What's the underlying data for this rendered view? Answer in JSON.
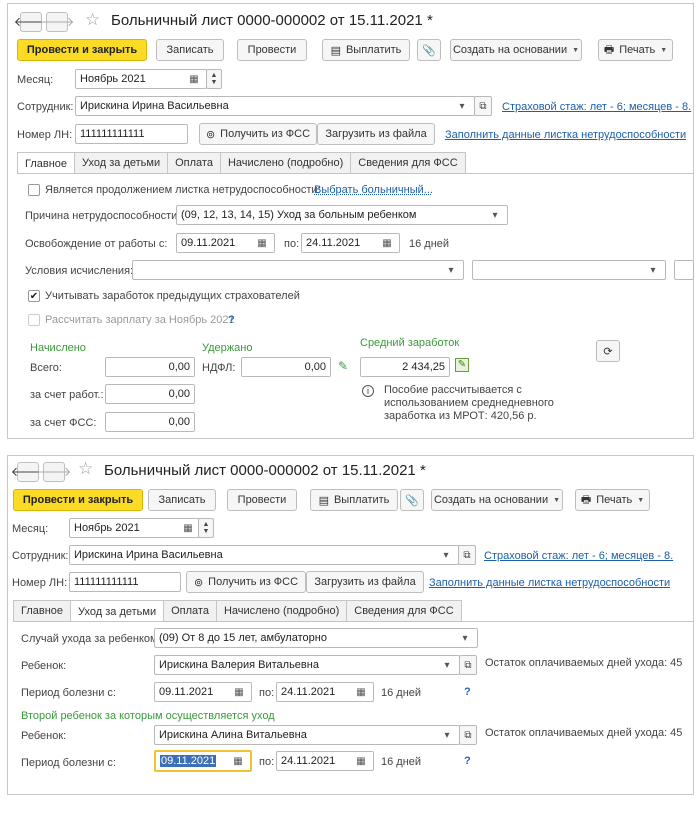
{
  "top": {
    "title": "Больничный лист 0000-000002 от 15.11.2021 *",
    "toolbar": {
      "post_close": "Провести и закрыть",
      "save": "Записать",
      "post": "Провести",
      "pay": "Выплатить",
      "create_based": "Создать на основании",
      "print": "Печать"
    },
    "month_label": "Месяц:",
    "month_value": "Ноябрь 2021",
    "employee_label": "Сотрудник:",
    "employee_value": "Ирискина Ирина Васильевна",
    "insurance_link": "Страховой стаж: лет - 6; месяцев - 8.",
    "ln_label": "Номер ЛН:",
    "ln_value": "111111111111",
    "get_fss": "Получить из ФСС",
    "load_file": "Загрузить из файла",
    "fill_link": "Заполнить данные листка нетрудоспособности",
    "tabs": [
      "Главное",
      "Уход за детьми",
      "Оплата",
      "Начислено (подробно)",
      "Сведения для ФСС"
    ],
    "main": {
      "continuation_label": "Является продолжением листка нетрудоспособности:",
      "choose_link": "Выбрать больничный...",
      "reason_label": "Причина нетрудоспособности:",
      "reason_value": "(09, 12, 13, 14, 15) Уход за больным ребенком",
      "release_label": "Освобождение от работы с:",
      "date_from": "09.11.2021",
      "po": "по:",
      "date_to": "24.11.2021",
      "days": "16 дней",
      "conditions_label": "Условия исчисления:",
      "prev_insurers": "Учитывать заработок предыдущих страхователей",
      "calc_salary": "Рассчитать зарплату за Ноябрь 2021",
      "question": "?",
      "accrued_header": "Начислено",
      "withheld_header": "Удержано",
      "avg_header": "Средний заработок",
      "total_label": "Всего:",
      "total_value": "0,00",
      "ndfl_label": "НДФЛ:",
      "ndfl_value": "0,00",
      "avg_value": "2 434,25",
      "employer_label": "за счет работ.:",
      "employer_value": "0,00",
      "fss_label": "за счет ФСС:",
      "fss_value": "0,00",
      "info_text": [
        "Пособие рассчитывается с",
        "использованием среднедневного",
        "заработка из МРОТ: 420,56 р."
      ]
    }
  },
  "bottom": {
    "title": "Больничный лист 0000-000002 от 15.11.2021 *",
    "toolbar": {
      "post_close": "Провести и закрыть",
      "save": "Записать",
      "post": "Провести",
      "pay": "Выплатить",
      "create_based": "Создать на основании",
      "print": "Печать"
    },
    "month_label": "Месяц:",
    "month_value": "Ноябрь 2021",
    "employee_label": "Сотрудник:",
    "employee_value": "Ирискина Ирина Васильевна",
    "insurance_link": "Страховой стаж: лет - 6; месяцев - 8.",
    "ln_label": "Номер ЛН:",
    "ln_value": "111111111111",
    "get_fss": "Получить из ФСС",
    "load_file": "Загрузить из файла",
    "fill_link": "Заполнить данные листка нетрудоспособности",
    "tabs": [
      "Главное",
      "Уход за детьми",
      "Оплата",
      "Начислено (подробно)",
      "Сведения для ФСС"
    ],
    "care": {
      "case_label": "Случай ухода за ребенком:",
      "case_value": "(09) От 8 до 15 лет, амбулаторно",
      "child_label": "Ребенок:",
      "child1_value": "Ирискина Валерия Витальевна",
      "remaining1": "Остаток оплачиваемых дней ухода: 45",
      "period_label": "Период болезни с:",
      "period1_from": "09.11.2021",
      "po": "по:",
      "period1_to": "24.11.2021",
      "days1": "16 дней",
      "question": "?",
      "second_child_header": "Второй ребенок за которым осуществляется уход",
      "child2_value": "Ирискина Алина Витальевна",
      "remaining2": "Остаток оплачиваемых дней ухода: 45",
      "period2_from": "09.11.2021",
      "period2_to": "24.11.2021",
      "days2": "16 дней"
    }
  }
}
